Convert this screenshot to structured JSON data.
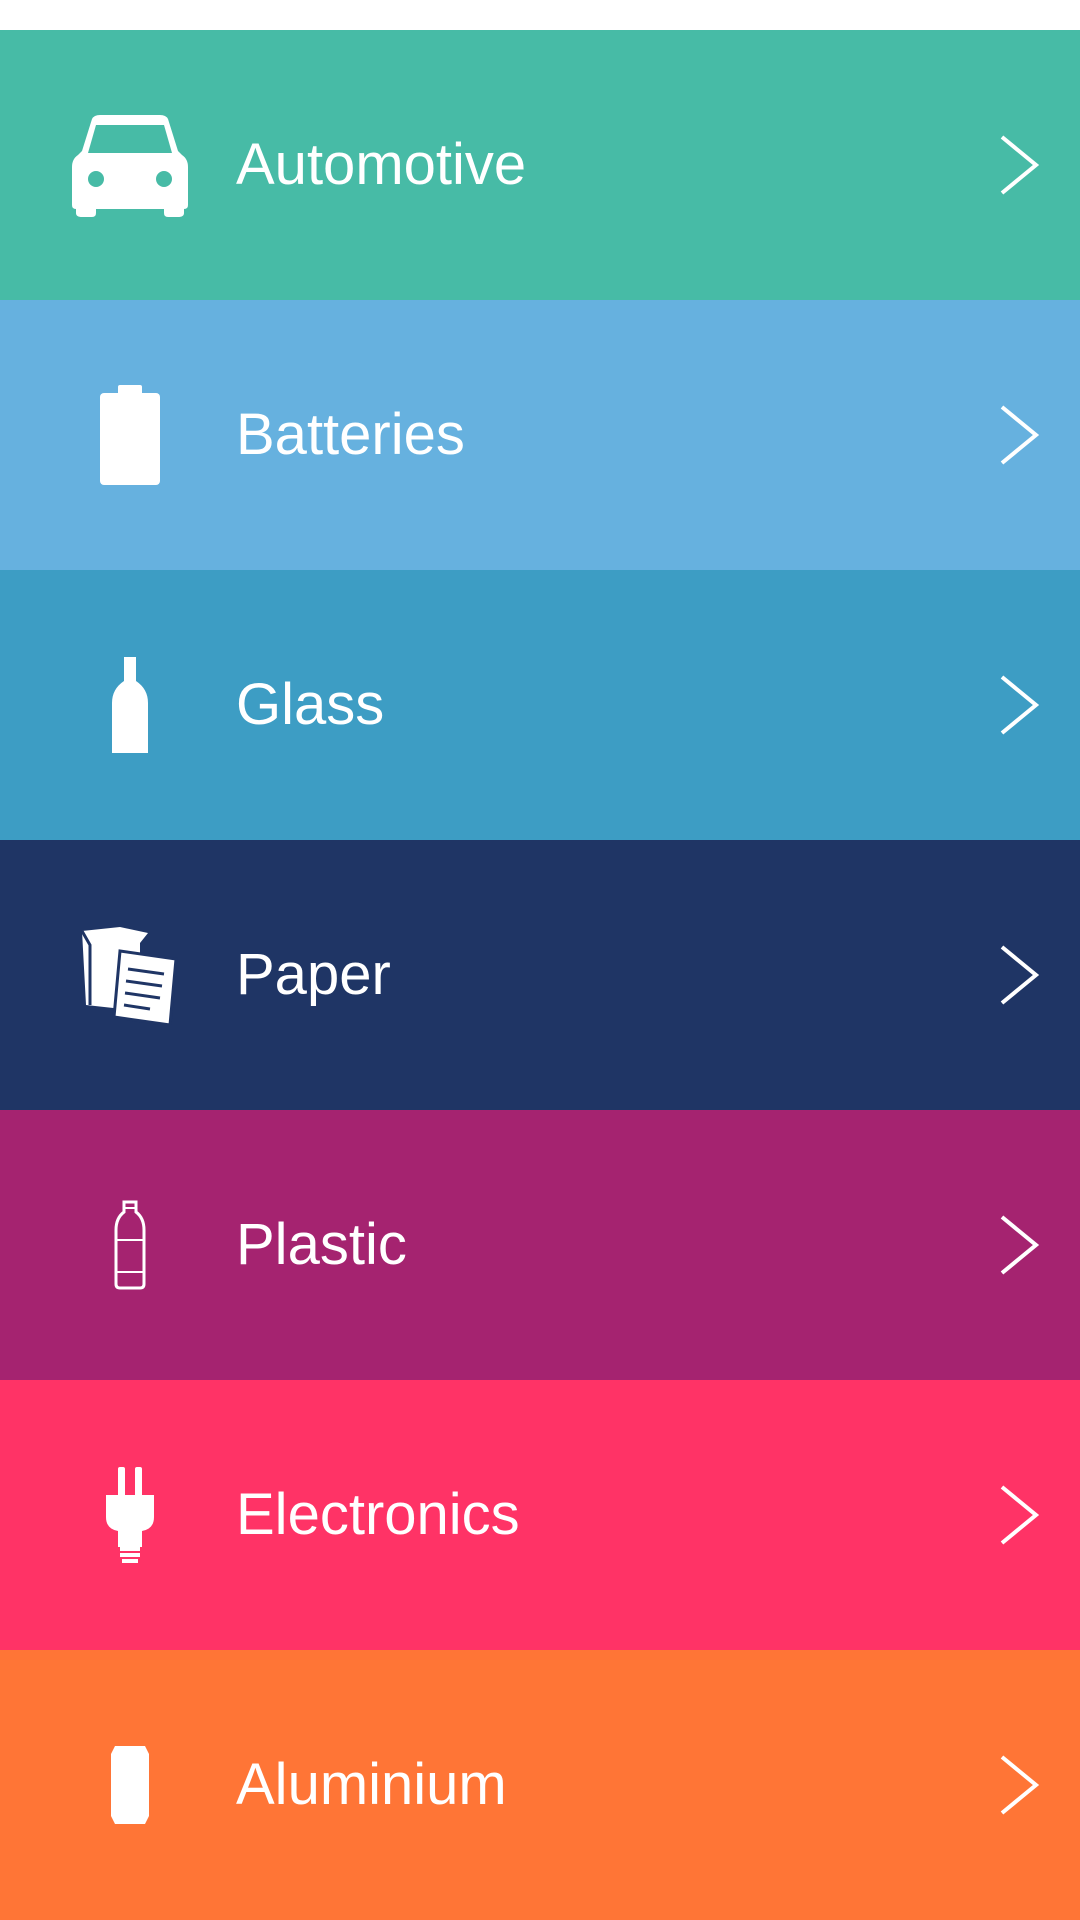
{
  "categories": [
    {
      "label": "Automotive",
      "icon": "car-icon",
      "color": "#47BBA6"
    },
    {
      "label": "Batteries",
      "icon": "battery-icon",
      "color": "#66B1DF"
    },
    {
      "label": "Glass",
      "icon": "bottle-icon",
      "color": "#3D9DC4"
    },
    {
      "label": "Paper",
      "icon": "paper-icon",
      "color": "#1F3565"
    },
    {
      "label": "Plastic",
      "icon": "plastic-bottle-icon",
      "color": "#A52370"
    },
    {
      "label": "Electronics",
      "icon": "plug-icon",
      "color": "#FF3366"
    },
    {
      "label": "Aluminium",
      "icon": "can-icon",
      "color": "#FF7536"
    }
  ]
}
